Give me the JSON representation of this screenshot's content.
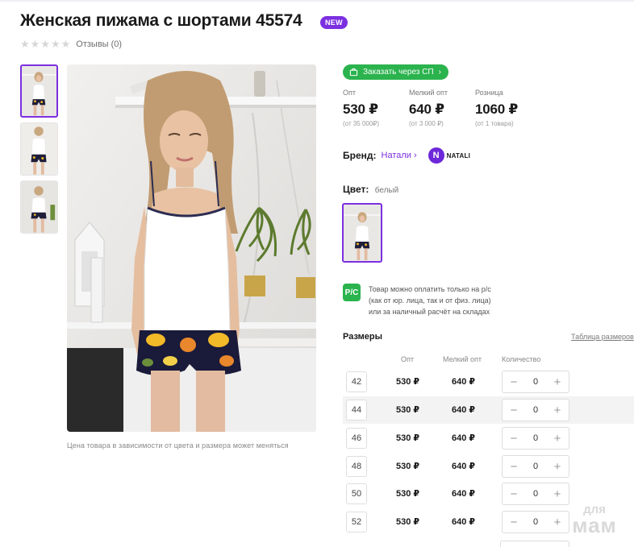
{
  "product": {
    "title": "Женская пижама с шортами 45574",
    "badge": "NEW",
    "rating": 0,
    "reviews_label": "Отзывы (0)"
  },
  "photo_note": "Цена товара в зависимости от цвета и размера может меняться",
  "sp_button": {
    "label": "Заказать через СП",
    "icon": "shopping-bag-icon",
    "color": "#2bb34e"
  },
  "prices": [
    {
      "label": "Опт",
      "value": "530 ₽",
      "sub": "(от 35 000₽)"
    },
    {
      "label": "Мелкий опт",
      "value": "640 ₽",
      "sub": "(от 3 000 ₽)"
    },
    {
      "label": "Розница",
      "value": "1060 ₽",
      "sub": "(от 1 товара)"
    }
  ],
  "brand": {
    "label": "Бренд:",
    "name": "Натали",
    "logo_letter": "N",
    "logo_text": "NATALI"
  },
  "color": {
    "label": "Цвет:",
    "value": "белый"
  },
  "payment": {
    "icon_text": "Р/С",
    "lines": [
      "Товар можно оплатить только на р/с",
      "(как от юр. лица, так и от физ. лица)",
      "или за наличный расчёт на складах"
    ]
  },
  "sizes": {
    "title": "Размеры",
    "table_link": "Таблица размеров",
    "headers": {
      "opt": "Опт",
      "small_opt": "Мелкий опт",
      "qty": "Количество"
    },
    "rows": [
      {
        "size": "42",
        "opt": "530 ₽",
        "small_opt": "640 ₽",
        "qty": "0"
      },
      {
        "size": "44",
        "opt": "530 ₽",
        "small_opt": "640 ₽",
        "qty": "0"
      },
      {
        "size": "46",
        "opt": "530 ₽",
        "small_opt": "640 ₽",
        "qty": "0"
      },
      {
        "size": "48",
        "opt": "530 ₽",
        "small_opt": "640 ₽",
        "qty": "0"
      },
      {
        "size": "50",
        "opt": "530 ₽",
        "small_opt": "640 ₽",
        "qty": "0"
      },
      {
        "size": "52",
        "opt": "530 ₽",
        "small_opt": "640 ₽",
        "qty": "0"
      }
    ],
    "minus": "−",
    "plus": "+"
  },
  "watermark": {
    "line1": "для",
    "line2": "мам"
  },
  "colors": {
    "accent": "#7b2fe0",
    "green": "#2bb34e"
  }
}
